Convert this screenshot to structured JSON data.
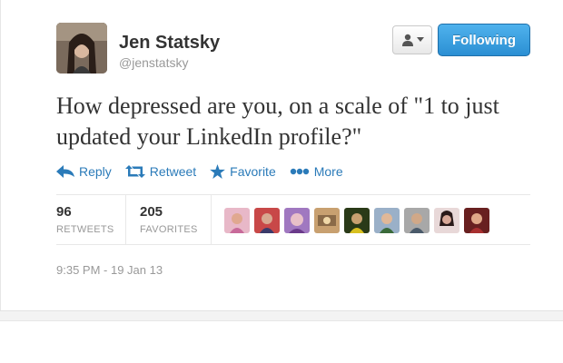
{
  "user": {
    "name": "Jen Statsky",
    "handle": "@jenstatsky",
    "avatar_icon": "profile-photo"
  },
  "buttons": {
    "user_actions_icon": "user-dropdown-icon",
    "follow_label": "Following"
  },
  "tweet": {
    "text": "How depressed are you, on a scale of \"1 to just updated your LinkedIn profile?\""
  },
  "actions": [
    {
      "label": "Reply",
      "icon": "reply-icon"
    },
    {
      "label": "Retweet",
      "icon": "retweet-icon"
    },
    {
      "label": "Favorite",
      "icon": "star-icon"
    },
    {
      "label": "More",
      "icon": "more-dots-icon"
    }
  ],
  "stats": {
    "retweets_count": "96",
    "retweets_label": "RETWEETS",
    "favorites_count": "205",
    "favorites_label": "FAVORITES"
  },
  "favoriters_count_shown": 9,
  "timestamp": "9:35 PM - 19 Jan 13",
  "colors": {
    "accent": "#2b7bb9",
    "follow_button": "#2b8fd3",
    "text": "#333333",
    "muted": "#999999"
  }
}
